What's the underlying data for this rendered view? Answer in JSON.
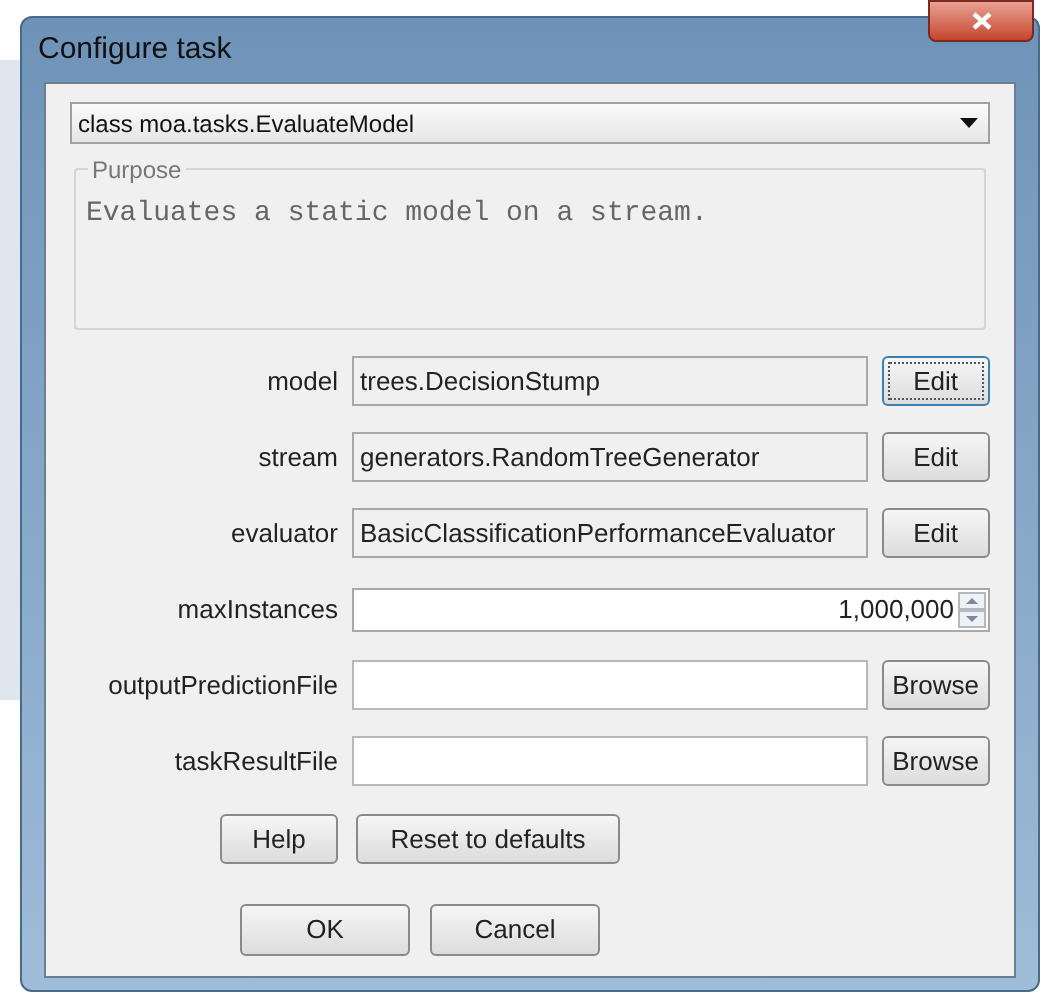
{
  "window": {
    "title": "Configure task"
  },
  "task_class": {
    "value": "class moa.tasks.EvaluateModel"
  },
  "purpose": {
    "legend": "Purpose",
    "text": "Evaluates a static model on a stream."
  },
  "options": [
    {
      "kind": "class",
      "label": "model",
      "value": "trees.DecisionStump",
      "button": "Edit",
      "focused": true
    },
    {
      "kind": "class",
      "label": "stream",
      "value": "generators.RandomTreeGenerator",
      "button": "Edit",
      "focused": false
    },
    {
      "kind": "class",
      "label": "evaluator",
      "value": "BasicClassificationPerformanceEvaluator",
      "button": "Edit",
      "focused": false
    },
    {
      "kind": "number",
      "label": "maxInstances",
      "value": "1,000,000"
    },
    {
      "kind": "file",
      "label": "outputPredictionFile",
      "button": "Browse",
      "focused": false
    },
    {
      "kind": "file",
      "label": "taskResultFile",
      "button": "Browse",
      "focused": false
    }
  ],
  "buttons_row_1": [
    "Help",
    "Reset to defaults"
  ],
  "buttons_row_2": [
    "OK",
    "Cancel"
  ]
}
